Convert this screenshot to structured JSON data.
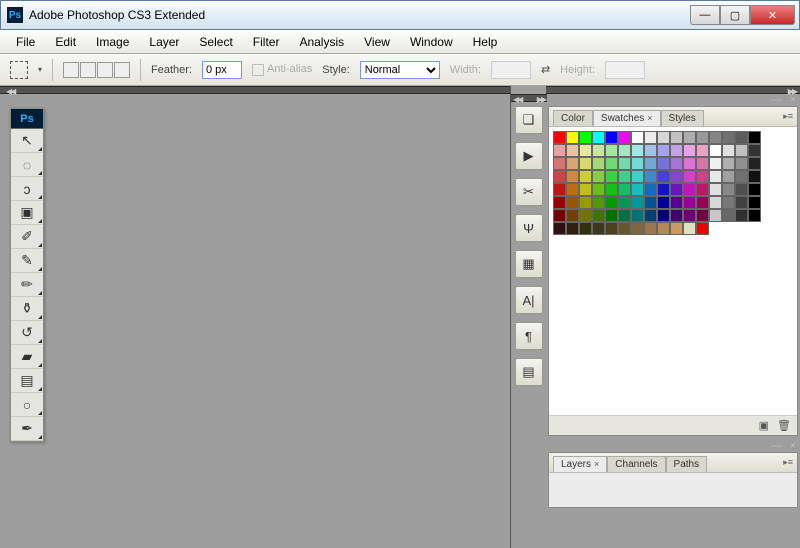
{
  "title": "Adobe Photoshop CS3 Extended",
  "ps_abbrev": "Ps",
  "menu": [
    "File",
    "Edit",
    "Image",
    "Layer",
    "Select",
    "Filter",
    "Analysis",
    "View",
    "Window",
    "Help"
  ],
  "options": {
    "feather_label": "Feather:",
    "feather_value": "0 px",
    "antialias_label": "Anti-alias",
    "style_label": "Style:",
    "style_value": "Normal",
    "width_label": "Width:",
    "height_label": "Height:"
  },
  "tools": [
    {
      "name": "move-tool",
      "glyph": "↖"
    },
    {
      "name": "marquee-tool",
      "glyph": "◌"
    },
    {
      "name": "lasso-tool",
      "glyph": "ɔ"
    },
    {
      "name": "crop-tool",
      "glyph": "▣"
    },
    {
      "name": "eyedropper-tool",
      "glyph": "✐"
    },
    {
      "name": "healing-tool",
      "glyph": "✎"
    },
    {
      "name": "brush-tool",
      "glyph": "✏"
    },
    {
      "name": "stamp-tool",
      "glyph": "⚱"
    },
    {
      "name": "history-brush-tool",
      "glyph": "↺"
    },
    {
      "name": "eraser-tool",
      "glyph": "▰"
    },
    {
      "name": "gradient-tool",
      "glyph": "▤"
    },
    {
      "name": "blur-tool",
      "glyph": "○"
    },
    {
      "name": "pen-tool",
      "glyph": "✒"
    }
  ],
  "iconstrip": [
    {
      "name": "navigator-icon",
      "glyph": "❏"
    },
    {
      "name": "histogram-icon",
      "glyph": "▶"
    },
    {
      "name": "tools-preset-icon",
      "glyph": "✂"
    },
    {
      "name": "brushes-icon",
      "glyph": "Ψ"
    },
    {
      "name": "clone-icon",
      "glyph": "▦"
    },
    {
      "name": "character-icon",
      "glyph": "A|"
    },
    {
      "name": "paragraph-icon",
      "glyph": "¶"
    },
    {
      "name": "layercomp-icon",
      "glyph": "▤"
    }
  ],
  "panel1": {
    "tabs": [
      {
        "label": "Color",
        "active": false
      },
      {
        "label": "Swatches",
        "active": true
      },
      {
        "label": "Styles",
        "active": false
      }
    ]
  },
  "panel2": {
    "tabs": [
      {
        "label": "Layers",
        "active": true
      },
      {
        "label": "Channels",
        "active": false
      },
      {
        "label": "Paths",
        "active": false
      }
    ]
  },
  "swatch_colors": [
    "#ff0000",
    "#ffff00",
    "#00ff00",
    "#00ffff",
    "#0000ff",
    "#ff00ff",
    "#ffffff",
    "#ebebeb",
    "#d6d6d6",
    "#c2c2c2",
    "#adadad",
    "#999999",
    "#858585",
    "#707070",
    "#5c5c5c",
    "#000000",
    "#e6a3a3",
    "#e6c3a3",
    "#e6e6a3",
    "#c3e6a3",
    "#a3e6a3",
    "#a3e6c3",
    "#a3e6e6",
    "#a3c3e6",
    "#a3a3e6",
    "#c3a3e6",
    "#e6a3e6",
    "#e6a3c3",
    "#ffffff",
    "#e0e0e0",
    "#c0c0c0",
    "#333333",
    "#d97373",
    "#d9a673",
    "#d9d973",
    "#a6d973",
    "#73d973",
    "#73d9a6",
    "#73d9d9",
    "#73a6d9",
    "#7373d9",
    "#a673d9",
    "#d973d9",
    "#d973a6",
    "#f0f0f0",
    "#b0b0b0",
    "#909090",
    "#222222",
    "#cc4444",
    "#cc8844",
    "#cccc44",
    "#88cc44",
    "#44cc44",
    "#44cc88",
    "#44cccc",
    "#4488cc",
    "#4444cc",
    "#8844cc",
    "#cc44cc",
    "#cc4488",
    "#e8e8e8",
    "#a0a0a0",
    "#707070",
    "#111111",
    "#bf1515",
    "#bf6a15",
    "#bfbf15",
    "#6abf15",
    "#15bf15",
    "#15bf6a",
    "#15bfbf",
    "#156abf",
    "#1515bf",
    "#6a15bf",
    "#bf15bf",
    "#bf156a",
    "#e0e0e0",
    "#888888",
    "#505050",
    "#000000",
    "#990000",
    "#995500",
    "#999900",
    "#559900",
    "#009900",
    "#009955",
    "#009999",
    "#005599",
    "#000099",
    "#550099",
    "#990099",
    "#990055",
    "#d8d8d8",
    "#787878",
    "#404040",
    "#000000",
    "#730000",
    "#734000",
    "#737300",
    "#407300",
    "#007300",
    "#007340",
    "#007373",
    "#004073",
    "#000073",
    "#400073",
    "#730073",
    "#730040",
    "#c8c8c8",
    "#686868",
    "#303030",
    "#000000",
    "#301010",
    "#302010",
    "#303010",
    "#3a3a1a",
    "#4d4020",
    "#665533",
    "#806640",
    "#99774d",
    "#b38859",
    "#cc9966",
    "#e0e0c0",
    "#f00000"
  ]
}
